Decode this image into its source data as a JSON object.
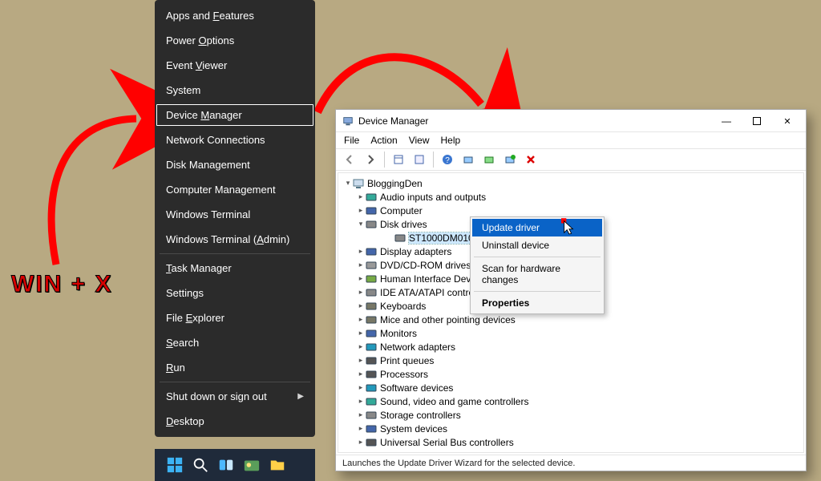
{
  "annotation": {
    "shortcut_label": "WIN + X"
  },
  "winx_menu": {
    "items": [
      {
        "label": "Apps and Features",
        "ul": "F"
      },
      {
        "label": "Power Options",
        "ul": "O"
      },
      {
        "label": "Event Viewer",
        "ul": "V"
      },
      {
        "label": "System",
        "ul": "Y"
      },
      {
        "label": "Device Manager",
        "ul": "M",
        "highlighted": true
      },
      {
        "label": "Network Connections",
        "ul": "W"
      },
      {
        "label": "Disk Management",
        "ul": "K"
      },
      {
        "label": "Computer Management",
        "ul": "G"
      },
      {
        "label": "Windows Terminal",
        "ul": "I"
      },
      {
        "label": "Windows Terminal (Admin)",
        "ul": "A"
      }
    ],
    "items2": [
      {
        "label": "Task Manager",
        "ul": "T"
      },
      {
        "label": "Settings",
        "ul": "N"
      },
      {
        "label": "File Explorer",
        "ul": "E"
      },
      {
        "label": "Search",
        "ul": "S"
      },
      {
        "label": "Run",
        "ul": "R"
      }
    ],
    "items3": [
      {
        "label": "Shut down or sign out",
        "ul": "U",
        "submenu": true
      },
      {
        "label": "Desktop",
        "ul": "D"
      }
    ]
  },
  "devmgr": {
    "title": "Device Manager",
    "menubar": [
      "File",
      "Action",
      "View",
      "Help"
    ],
    "root": "BloggingDen",
    "nodes": [
      {
        "label": "Audio inputs and outputs",
        "icon": "audio"
      },
      {
        "label": "Computer",
        "icon": "computer"
      },
      {
        "label": "Disk drives",
        "icon": "disk",
        "expanded": true,
        "children": [
          {
            "label": "ST1000DM010-2EP102 ATA Device",
            "icon": "disk",
            "selected": true
          }
        ]
      },
      {
        "label": "Display adapters",
        "icon": "display"
      },
      {
        "label": "DVD/CD-ROM drives",
        "icon": "dvd"
      },
      {
        "label": "Human Interface Devices",
        "icon": "hid"
      },
      {
        "label": "IDE ATA/ATAPI controllers",
        "icon": "ide"
      },
      {
        "label": "Keyboards",
        "icon": "kbd"
      },
      {
        "label": "Mice and other pointing devices",
        "icon": "mouse"
      },
      {
        "label": "Monitors",
        "icon": "monitor"
      },
      {
        "label": "Network adapters",
        "icon": "net"
      },
      {
        "label": "Print queues",
        "icon": "print"
      },
      {
        "label": "Processors",
        "icon": "cpu"
      },
      {
        "label": "Software devices",
        "icon": "soft"
      },
      {
        "label": "Sound, video and game controllers",
        "icon": "sound"
      },
      {
        "label": "Storage controllers",
        "icon": "stor"
      },
      {
        "label": "System devices",
        "icon": "sys"
      },
      {
        "label": "Universal Serial Bus controllers",
        "icon": "usb"
      }
    ],
    "context_menu": {
      "items": [
        {
          "label": "Update driver",
          "highlighted": true
        },
        {
          "label": "Uninstall device"
        }
      ],
      "items2": [
        {
          "label": "Scan for hardware changes"
        }
      ],
      "items3": [
        {
          "label": "Properties",
          "bold": true
        }
      ]
    },
    "status": "Launches the Update Driver Wizard for the selected device."
  }
}
